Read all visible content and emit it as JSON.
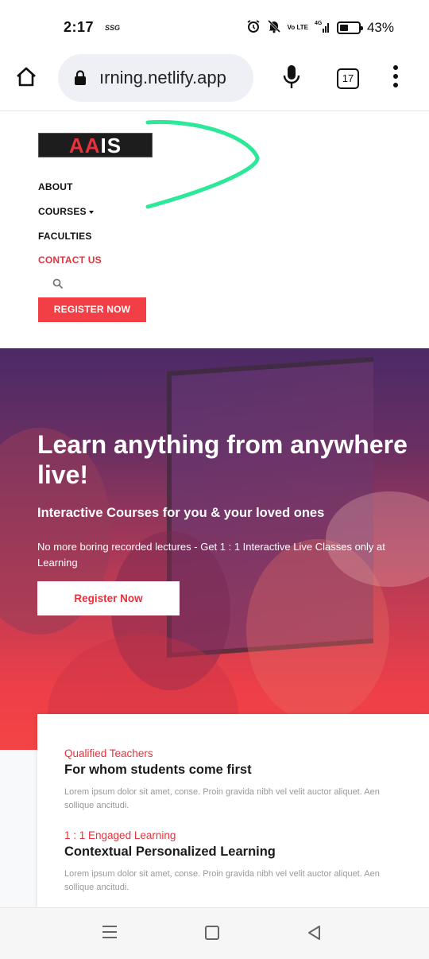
{
  "status_bar": {
    "time": "2:17",
    "carrier_badge": "SSG",
    "network": "4G",
    "volte": "Vo LTE",
    "battery_percent": "43%",
    "icons": [
      "alarm-icon",
      "mute-icon",
      "volte-icon",
      "signal-icon",
      "battery-icon"
    ]
  },
  "browser": {
    "url": "ırning.netlify.app",
    "tab_count": "17",
    "icons": [
      "home-icon",
      "lock-icon",
      "mic-icon",
      "tabs-icon",
      "overflow-menu-icon"
    ]
  },
  "site_header": {
    "logo_red": "AA",
    "logo_white": "IS",
    "nav": {
      "about": "ABOUT",
      "courses": "COURSES",
      "faculties": "FACULTIES",
      "contact": "CONTACT US"
    },
    "register_button": "REGISTER NOW"
  },
  "hero": {
    "title_line1": "Learn anything from anywhere",
    "title_line2": "live!",
    "subtitle": "Interactive Courses for you & your loved ones",
    "description": "No more boring recorded lectures - Get 1 : 1 Interactive Live Classes only at",
    "description_line2": "Learning",
    "button": "Register Now"
  },
  "features": [
    {
      "tag": "Qualified Teachers",
      "title": "For whom students come first",
      "text": "Lorem ipsum dolor sit amet, conse. Proin gravida nibh vel velit auctor aliquet. Aen",
      "text_line2": "sollique ancitudi."
    },
    {
      "tag": "1 : 1 Engaged Learning",
      "title": "Contextual Personalized Learning",
      "text": "Lorem ipsum dolor sit amet, conse. Proin gravida nibh vel velit auctor aliquet. Aen",
      "text_line2": "sollique ancitudi."
    }
  ],
  "colors": {
    "brand_red": "#e8313c",
    "annotation_green": "#2ee89a"
  }
}
